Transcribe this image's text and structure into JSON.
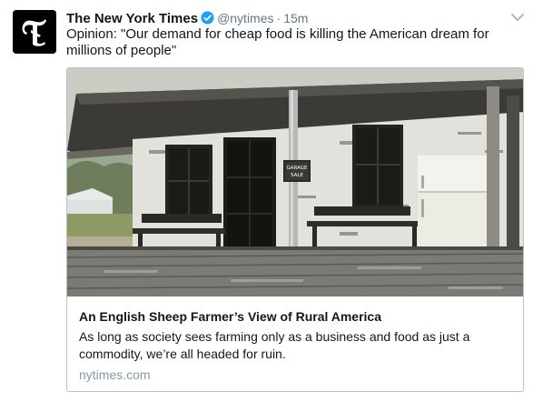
{
  "tweet": {
    "display_name": "The New York Times",
    "handle": "@nytimes",
    "separator": "·",
    "time": "15m",
    "text": "Opinion: \"Our demand for cheap food is killing the American dream for millions of people\""
  },
  "card": {
    "title": "An English Sheep Farmer’s View of Rural America",
    "description": "As long as society sees farming only as a business and food as just a commodity, we’re all headed for ruin.",
    "domain": "nytimes.com",
    "sign_text": "GARAGE SALE"
  },
  "colors": {
    "verified_blue": "#1da1f2",
    "secondary_text": "#657786",
    "domain_text": "#8899a6",
    "card_border": "#bcc1c6"
  },
  "icons": {
    "avatar": "nyt-logo-icon",
    "verified": "verified-badge-icon",
    "caret": "chevron-down-icon"
  }
}
